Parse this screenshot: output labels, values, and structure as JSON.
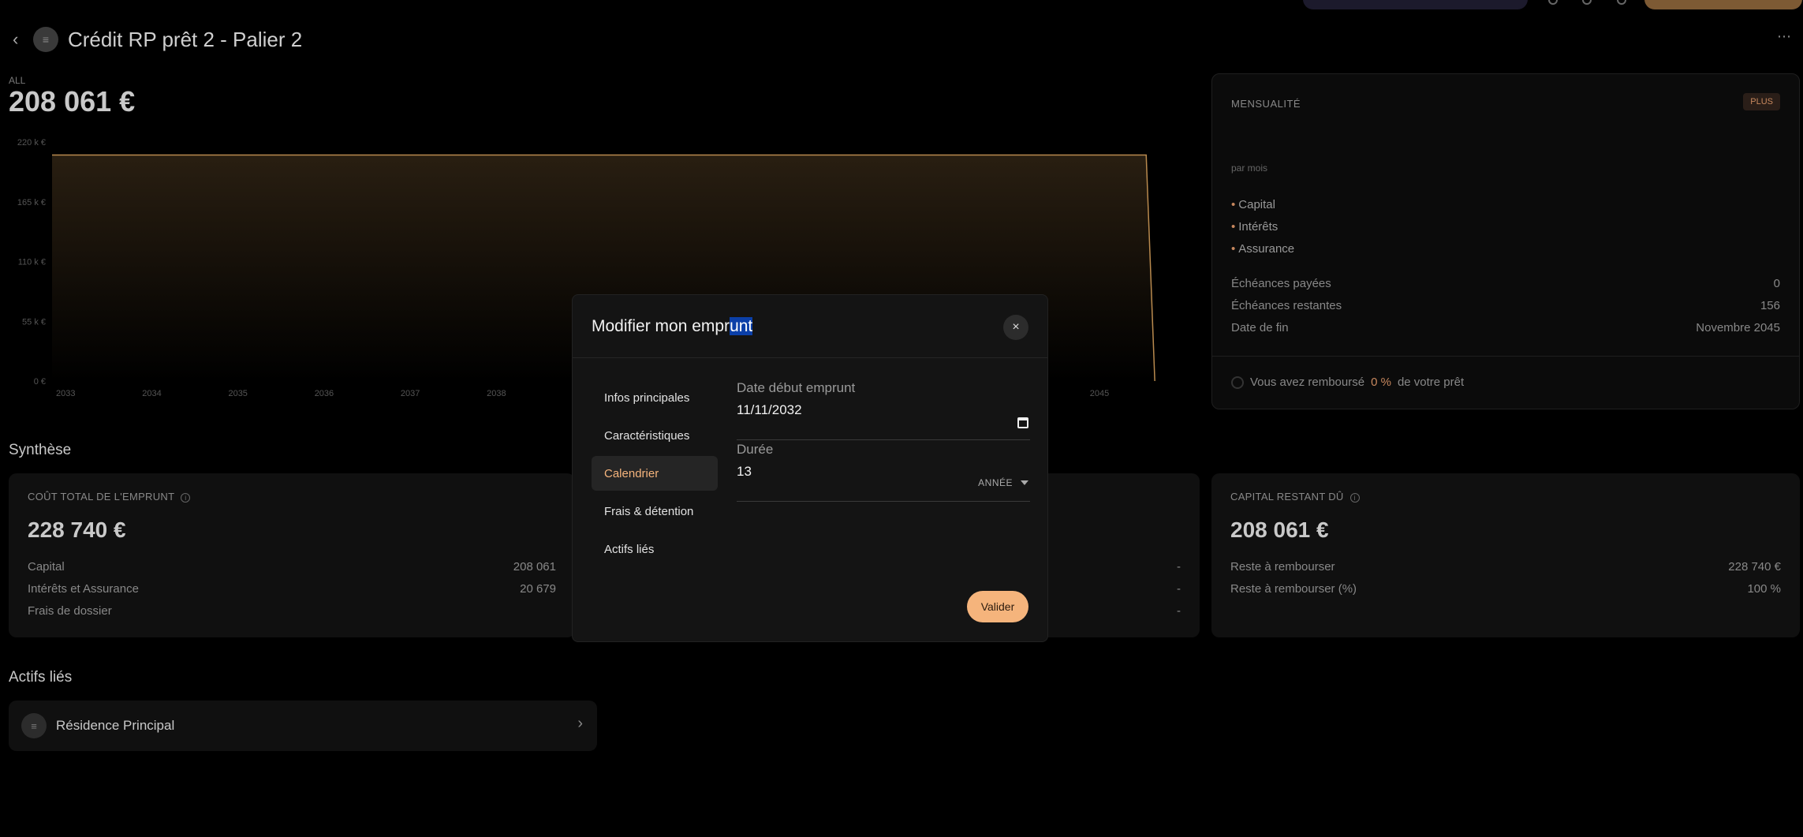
{
  "page": {
    "title": "Crédit RP prêt 2 - Palier 2",
    "all_label": "ALL",
    "balance": "208 061 €",
    "more": "⋯"
  },
  "chart_data": {
    "type": "area",
    "title": "",
    "x": [
      "2033",
      "2034",
      "2035",
      "2036",
      "2037",
      "2038",
      "2045"
    ],
    "ytick_labels": [
      "220 k €",
      "165 k €",
      "110 k €",
      "55 k €",
      "0 €"
    ],
    "ylim": [
      0,
      220000
    ],
    "series": [
      {
        "values_note": "",
        "points": [
          [
            2033,
            208061
          ],
          [
            2045.7,
            208061
          ],
          [
            2045.8,
            0
          ]
        ]
      }
    ],
    "grid": false,
    "color": "#b98a4e"
  },
  "mensualite": {
    "title": "MENSUALITÉ",
    "badge": "PLUS",
    "per_month": "par mois",
    "legend": [
      "Capital",
      "Intérêts",
      "Assurance"
    ],
    "rows": [
      {
        "label": "Échéances payées",
        "value": "0"
      },
      {
        "label": "Échéances restantes",
        "value": "156"
      },
      {
        "label": "Date de fin",
        "value": "Novembre 2045"
      }
    ],
    "rembourse_prefix": "Vous avez remboursé",
    "rembourse_pct": "0 %",
    "rembourse_suffix": "de votre prêt"
  },
  "synthese": {
    "title": "Synthèse",
    "cout": {
      "title": "COÛT TOTAL DE L'EMPRUNT",
      "amount": "228 740 €",
      "rows": [
        {
          "label": "Capital",
          "value": "208 061"
        },
        {
          "label": "Intérêts et Assurance",
          "value": "20 679"
        },
        {
          "label": "Frais de dossier",
          "value": ""
        }
      ]
    },
    "middle_rows": [
      "-",
      "-",
      "-"
    ],
    "capital": {
      "title": "CAPITAL RESTANT DÛ",
      "amount": "208 061 €",
      "rows": [
        {
          "label": "Reste à rembourser",
          "value": "228 740 €"
        },
        {
          "label": "Reste à rembourser (%)",
          "value": "100 %"
        }
      ]
    }
  },
  "actifs": {
    "title": "Actifs liés",
    "items": [
      {
        "name": "Résidence Principal"
      }
    ]
  },
  "modal": {
    "title_start": "Modifier mon empr",
    "title_selected": "unt",
    "close": "×",
    "menu": [
      {
        "label": "Infos principales",
        "active": false
      },
      {
        "label": "Caractéristiques",
        "active": false
      },
      {
        "label": "Calendrier",
        "active": true
      },
      {
        "label": "Frais & détention",
        "active": false
      },
      {
        "label": "Actifs liés",
        "active": false
      }
    ],
    "fields": {
      "date_label": "Date début emprunt",
      "date_value": "11/11/2032",
      "duree_label": "Durée",
      "duree_value": "13",
      "duree_unit": "ANNÉE"
    },
    "submit": "Valider"
  },
  "colors": {
    "accent": "#f5b47c",
    "background": "#000000",
    "modal": "#141414"
  }
}
